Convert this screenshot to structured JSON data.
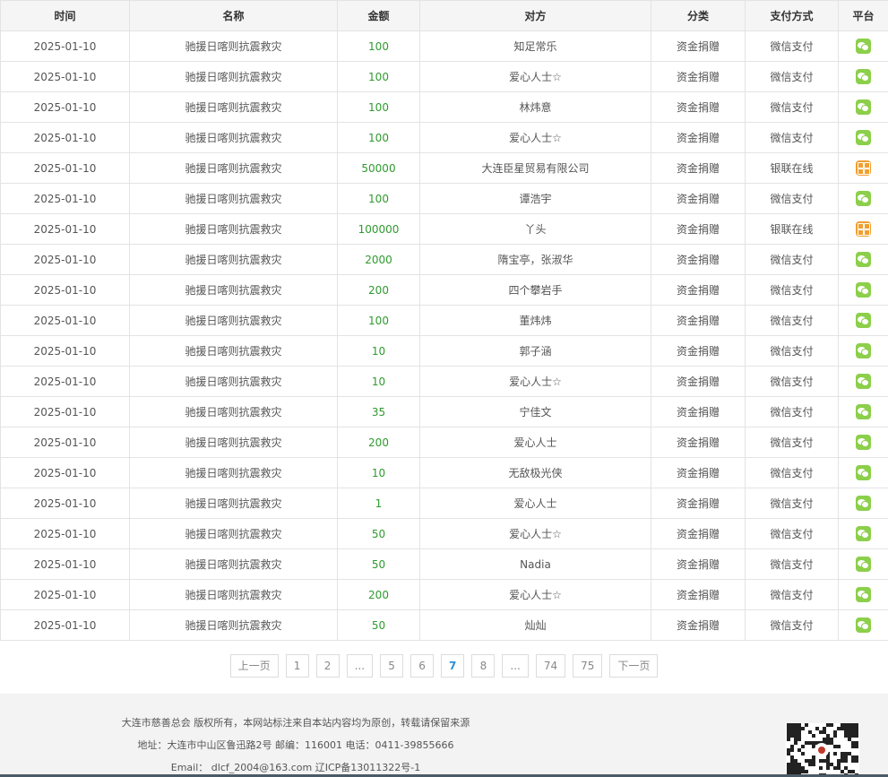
{
  "table": {
    "headers": [
      "时间",
      "名称",
      "金额",
      "对方",
      "分类",
      "支付方式",
      "平台"
    ],
    "rows": [
      {
        "time": "2025-01-10",
        "name": "驰援日喀则抗震救灾",
        "amount": "100",
        "party": "知足常乐",
        "category": "资金捐赠",
        "method": "微信支付",
        "platform": "wechat-icon"
      },
      {
        "time": "2025-01-10",
        "name": "驰援日喀则抗震救灾",
        "amount": "100",
        "party": "爱心人士☆",
        "category": "资金捐赠",
        "method": "微信支付",
        "platform": "wechat-icon"
      },
      {
        "time": "2025-01-10",
        "name": "驰援日喀则抗震救灾",
        "amount": "100",
        "party": "林炜意",
        "category": "资金捐赠",
        "method": "微信支付",
        "platform": "wechat-icon"
      },
      {
        "time": "2025-01-10",
        "name": "驰援日喀则抗震救灾",
        "amount": "100",
        "party": "爱心人士☆",
        "category": "资金捐赠",
        "method": "微信支付",
        "platform": "wechat-icon"
      },
      {
        "time": "2025-01-10",
        "name": "驰援日喀则抗震救灾",
        "amount": "50000",
        "party": "大连臣星贸易有限公司",
        "category": "资金捐赠",
        "method": "银联在线",
        "platform": "unionpay-icon"
      },
      {
        "time": "2025-01-10",
        "name": "驰援日喀则抗震救灾",
        "amount": "100",
        "party": "谭浩宇",
        "category": "资金捐赠",
        "method": "微信支付",
        "platform": "wechat-icon"
      },
      {
        "time": "2025-01-10",
        "name": "驰援日喀则抗震救灾",
        "amount": "100000",
        "party": "丫头",
        "category": "资金捐赠",
        "method": "银联在线",
        "platform": "unionpay-icon"
      },
      {
        "time": "2025-01-10",
        "name": "驰援日喀则抗震救灾",
        "amount": "2000",
        "party": "隋宝亭，张淑华",
        "category": "资金捐赠",
        "method": "微信支付",
        "platform": "wechat-icon"
      },
      {
        "time": "2025-01-10",
        "name": "驰援日喀则抗震救灾",
        "amount": "200",
        "party": "四个攀岩手",
        "category": "资金捐赠",
        "method": "微信支付",
        "platform": "wechat-icon"
      },
      {
        "time": "2025-01-10",
        "name": "驰援日喀则抗震救灾",
        "amount": "100",
        "party": "董炜炜",
        "category": "资金捐赠",
        "method": "微信支付",
        "platform": "wechat-icon"
      },
      {
        "time": "2025-01-10",
        "name": "驰援日喀则抗震救灾",
        "amount": "10",
        "party": "郭子涵",
        "category": "资金捐赠",
        "method": "微信支付",
        "platform": "wechat-icon"
      },
      {
        "time": "2025-01-10",
        "name": "驰援日喀则抗震救灾",
        "amount": "10",
        "party": "爱心人士☆",
        "category": "资金捐赠",
        "method": "微信支付",
        "platform": "wechat-icon"
      },
      {
        "time": "2025-01-10",
        "name": "驰援日喀则抗震救灾",
        "amount": "35",
        "party": "宁佳文",
        "category": "资金捐赠",
        "method": "微信支付",
        "platform": "wechat-icon"
      },
      {
        "time": "2025-01-10",
        "name": "驰援日喀则抗震救灾",
        "amount": "200",
        "party": "爱心人士",
        "category": "资金捐赠",
        "method": "微信支付",
        "platform": "wechat-icon"
      },
      {
        "time": "2025-01-10",
        "name": "驰援日喀则抗震救灾",
        "amount": "10",
        "party": "无敌极光侠",
        "category": "资金捐赠",
        "method": "微信支付",
        "platform": "wechat-icon"
      },
      {
        "time": "2025-01-10",
        "name": "驰援日喀则抗震救灾",
        "amount": "1",
        "party": "爱心人士",
        "category": "资金捐赠",
        "method": "微信支付",
        "platform": "wechat-icon"
      },
      {
        "time": "2025-01-10",
        "name": "驰援日喀则抗震救灾",
        "amount": "50",
        "party": "爱心人士☆",
        "category": "资金捐赠",
        "method": "微信支付",
        "platform": "wechat-icon"
      },
      {
        "time": "2025-01-10",
        "name": "驰援日喀则抗震救灾",
        "amount": "50",
        "party": "Nadia",
        "category": "资金捐赠",
        "method": "微信支付",
        "platform": "wechat-icon"
      },
      {
        "time": "2025-01-10",
        "name": "驰援日喀则抗震救灾",
        "amount": "200",
        "party": "爱心人士☆",
        "category": "资金捐赠",
        "method": "微信支付",
        "platform": "wechat-icon"
      },
      {
        "time": "2025-01-10",
        "name": "驰援日喀则抗震救灾",
        "amount": "50",
        "party": "灿灿",
        "category": "资金捐赠",
        "method": "微信支付",
        "platform": "wechat-icon"
      }
    ]
  },
  "pagination": {
    "prev": "上一页",
    "next": "下一页",
    "pages": [
      "1",
      "2",
      "...",
      "5",
      "6",
      "7",
      "8",
      "...",
      "74",
      "75"
    ],
    "current": "7"
  },
  "footer": {
    "copyright": "大连市慈善总会 版权所有，本网站标注来自本站内容均为原创，转载请保留来源",
    "address": "地址：大连市中山区鲁迅路2号 邮编：116001 电话：0411-39855666",
    "email": "Email： dlcf_2004@163.com 辽ICP备13011322号-1"
  },
  "colors": {
    "amount": "#2f9a2f",
    "wechat": "#8ccf4a",
    "unionpay": "#f0a030",
    "current_page": "#2b8fd6",
    "footer_bg": "#f3f3f3"
  }
}
